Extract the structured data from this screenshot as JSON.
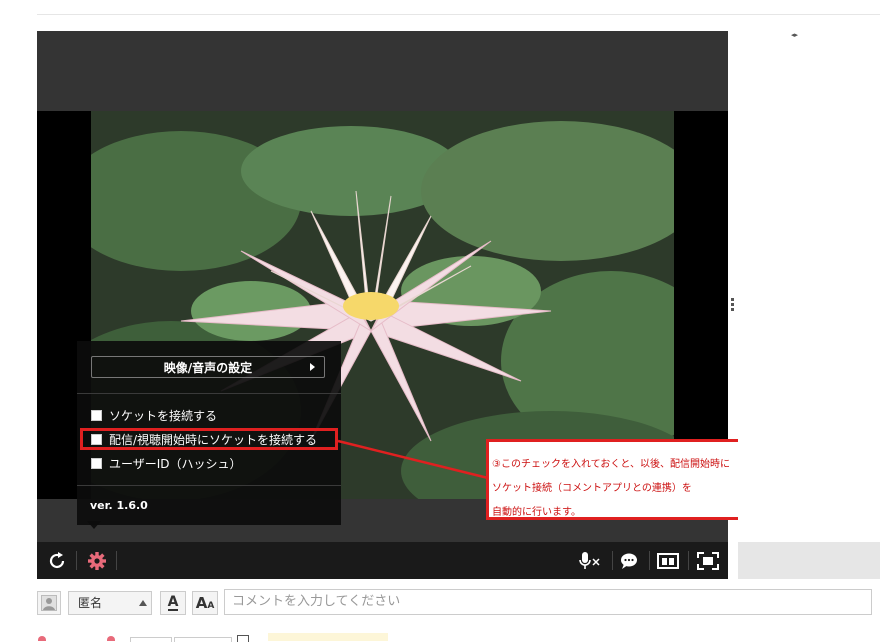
{
  "settings_menu": {
    "av_settings_label": "映像/音声の設定",
    "options": [
      {
        "label": "ソケットを接続する",
        "checked": false
      },
      {
        "label": "配信/視聴開始時にソケットを接続する",
        "checked": false
      },
      {
        "label": "ユーザーID（ハッシュ）",
        "checked": false
      }
    ],
    "version": "ver. 1.6.0"
  },
  "callout": {
    "lines": [
      "③このチェックを入れておくと、以後、配信開始時に",
      "ソケット接続（コメントアプリとの連携）を",
      "自動的に行います。"
    ],
    "color": "#e02020"
  },
  "controlbar": {
    "icons": [
      "refresh-icon",
      "gear-icon",
      "mic-muted-icon",
      "chat-bubble-icon",
      "layout-icon",
      "fullscreen-icon"
    ],
    "gear_color": "#e86a7a"
  },
  "comment_bar": {
    "name_value": "匿名",
    "font_color_label": "A",
    "font_size_label": "A",
    "input_placeholder": "コメントを入力してください"
  }
}
